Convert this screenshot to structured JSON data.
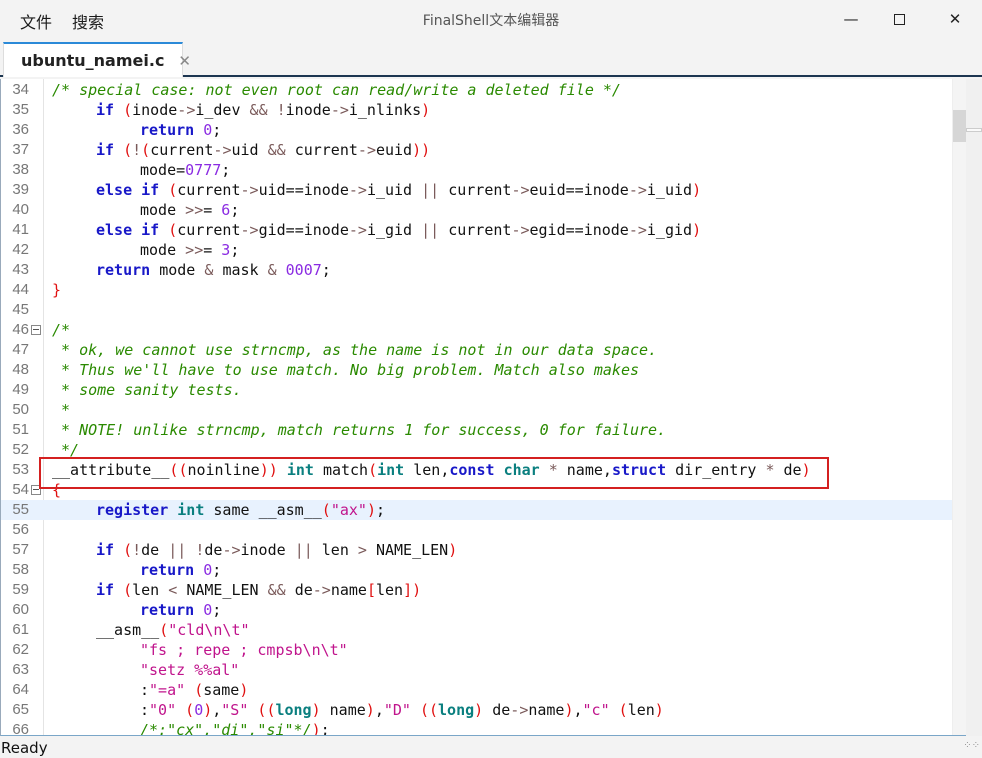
{
  "window": {
    "title": "FinalShell文本编辑器",
    "menu": [
      "文件",
      "搜索"
    ]
  },
  "tabs": [
    {
      "label": "ubuntu_namei.c",
      "active": true
    }
  ],
  "editor": {
    "current_line": 55,
    "highlighted_line": 53,
    "fold_lines": [
      46,
      54
    ],
    "lines": [
      {
        "n": 34,
        "text": "/* special case: not even root can read/write a deleted file */"
      },
      {
        "n": 35,
        "text": "\tif (inode->i_dev && !inode->i_nlinks)"
      },
      {
        "n": 36,
        "text": "\t\treturn 0;"
      },
      {
        "n": 37,
        "text": "\tif (!(current->uid && current->euid))"
      },
      {
        "n": 38,
        "text": "\t\tmode=0777;"
      },
      {
        "n": 39,
        "text": "\telse if (current->uid==inode->i_uid || current->euid==inode->i_uid)"
      },
      {
        "n": 40,
        "text": "\t\tmode >>= 6;"
      },
      {
        "n": 41,
        "text": "\telse if (current->gid==inode->i_gid || current->egid==inode->i_gid)"
      },
      {
        "n": 42,
        "text": "\t\tmode >>= 3;"
      },
      {
        "n": 43,
        "text": "\treturn mode & mask & 0007;"
      },
      {
        "n": 44,
        "text": "}"
      },
      {
        "n": 45,
        "text": ""
      },
      {
        "n": 46,
        "text": "/*"
      },
      {
        "n": 47,
        "text": " * ok, we cannot use strncmp, as the name is not in our data space."
      },
      {
        "n": 48,
        "text": " * Thus we'll have to use match. No big problem. Match also makes"
      },
      {
        "n": 49,
        "text": " * some sanity tests."
      },
      {
        "n": 50,
        "text": " *"
      },
      {
        "n": 51,
        "text": " * NOTE! unlike strncmp, match returns 1 for success, 0 for failure."
      },
      {
        "n": 52,
        "text": " */"
      },
      {
        "n": 53,
        "text": "__attribute__((noinline)) int match(int len,const char * name,struct dir_entry * de)"
      },
      {
        "n": 54,
        "text": "{"
      },
      {
        "n": 55,
        "text": "\tregister int same __asm__(\"ax\");"
      },
      {
        "n": 56,
        "text": ""
      },
      {
        "n": 57,
        "text": "\tif (!de || !de->inode || len > NAME_LEN)"
      },
      {
        "n": 58,
        "text": "\t\treturn 0;"
      },
      {
        "n": 59,
        "text": "\tif (len < NAME_LEN && de->name[len])"
      },
      {
        "n": 60,
        "text": "\t\treturn 0;"
      },
      {
        "n": 61,
        "text": "\t__asm__(\"cld\\n\\t\""
      },
      {
        "n": 62,
        "text": "\t\t\"fs ; repe ; cmpsb\\n\\t\""
      },
      {
        "n": 63,
        "text": "\t\t\"setz %%al\""
      },
      {
        "n": 64,
        "text": "\t\t:\"=a\" (same)"
      },
      {
        "n": 65,
        "text": "\t\t:\"0\" (0),\"S\" ((long) name),\"D\" ((long) de->name),\"c\" (len)"
      },
      {
        "n": 66,
        "text": "\t\t/*:\"cx\",\"di\",\"si\"*/);"
      }
    ]
  },
  "syntax_colors": {
    "comment": "#2a8a00",
    "keyword": "#1818c8",
    "type": "#0a7f7f",
    "number": "#8a2be2",
    "string": "#c0148c",
    "paren": "#e01010",
    "highlight_box": "#d42020"
  },
  "status": {
    "text": "Ready"
  }
}
